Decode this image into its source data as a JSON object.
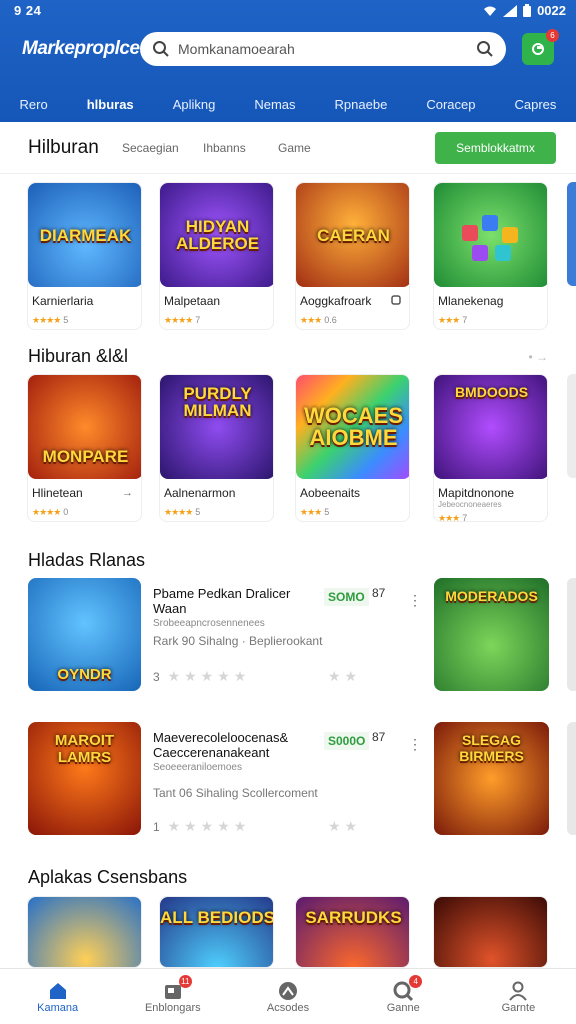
{
  "status": {
    "time": "9 24",
    "battery": "0022"
  },
  "header": {
    "brand": "Markeproplce",
    "search_placeholder": "Momkanamoearah",
    "nav_tabs": [
      "Rero",
      "hlburas",
      "Aplikng",
      "Nemas",
      "Rpnaebe",
      "Coracep",
      "Capres"
    ],
    "notif_badge": "6"
  },
  "subbar": {
    "title": "Hilburan",
    "chips": [
      "Secaegian",
      "Ihbanns",
      "Game"
    ],
    "cta": "Semblokkatmx"
  },
  "row1": {
    "cards": [
      {
        "thumb": "DIARMEAK",
        "name": "Karnierlaria",
        "stars": "★★★★",
        "num": "5",
        "bg": "#2a7fd6"
      },
      {
        "thumb": "HIDYAN ALDEROE",
        "name": "Malpetaan",
        "stars": "★★★★",
        "num": "7",
        "bg": "#5b2fb8"
      },
      {
        "thumb": "CAERAN",
        "name": "Aoggkafroark",
        "stars": "★★★",
        "num": "0.6",
        "bg": "#c7472a"
      },
      {
        "thumb": "",
        "name": "Mlanekenag",
        "stars": "★★★",
        "num": "7",
        "bg": "#2eb24a"
      }
    ]
  },
  "section2": {
    "title": "Hiburan &l&l",
    "cards": [
      {
        "thumb": "MONPARE",
        "name": "Hlinetean",
        "stars": "★★★★",
        "num": "0",
        "bg": "#d9401c"
      },
      {
        "thumb": "PURDLY MILMAN",
        "name": "Aalnenarmon",
        "stars": "★★★★",
        "num": "5",
        "bg": "#5a2aa8"
      },
      {
        "thumb": "WOCAES AIOBME",
        "name": "Aobeenaits",
        "stars": "★★★",
        "num": "5",
        "bg": "#ee7a1a"
      },
      {
        "thumb": "BMDOODS",
        "name": "Mapitdnonone",
        "sub": "Jebeocnoneaeres",
        "stars": "★★★",
        "num": "7",
        "bg": "#6a2ab2"
      }
    ]
  },
  "section3": {
    "title": "Hladas Rlanas",
    "items": [
      {
        "thumb": "OYNDR",
        "title": "Pbame Pedkan Dralicer Waan",
        "sub": "Srobeeapncrosennenees",
        "meta": "Rark 90   Sihalng · Beplierookant",
        "price": "SOMO",
        "rank": "87",
        "rthumb": "MODERADOS",
        "rating": "3",
        "bg": "#1c8fd2",
        "rbg": "#2d8f3c"
      },
      {
        "thumb": "MAROIT LAMRS",
        "title": "Maeverecoleloocenas& Caeccerenanakeant",
        "sub": "Seoeeeraniloemoes",
        "meta": "Tant 06   Sihaling   Scollercoment",
        "price": "S000O",
        "rank": "87",
        "rthumb": "SLEGAG BIRMERS",
        "rating": "1",
        "bg": "#c12e1a",
        "rbg": "#b84218"
      }
    ]
  },
  "section4": {
    "title": "Aplakas Csensbans",
    "thumbs": [
      {
        "label": "",
        "bg": "#2880d8"
      },
      {
        "label": "ALL BEDIODS",
        "bg": "#2b4fb8"
      },
      {
        "label": "SARRUDKS",
        "bg": "#c8351f"
      },
      {
        "label": "",
        "bg": "#8c1e12"
      }
    ]
  },
  "bottom_nav": [
    {
      "label": "Kamana",
      "icon": "home-icon",
      "active": true
    },
    {
      "label": "Enblongars",
      "icon": "bag-icon",
      "badge": "11"
    },
    {
      "label": "Acsodes",
      "icon": "apps-icon"
    },
    {
      "label": "Ganne",
      "icon": "search-icon",
      "badge": "4"
    },
    {
      "label": "Garnte",
      "icon": "person-icon"
    }
  ],
  "colors": {
    "primary": "#1f63c6",
    "accent": "#3fb24a",
    "star": "#f4a11a"
  }
}
